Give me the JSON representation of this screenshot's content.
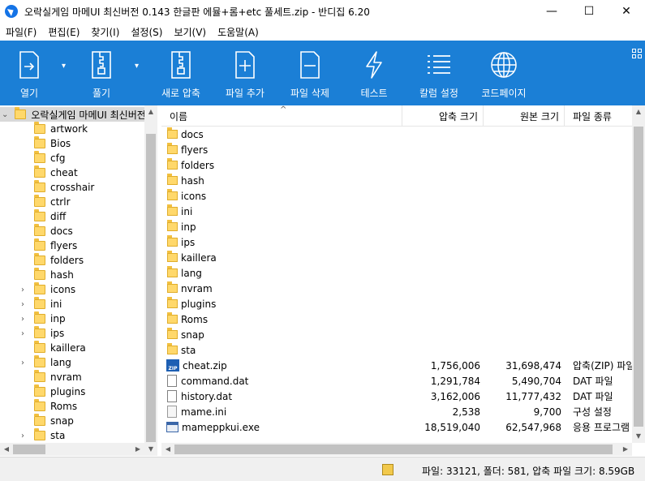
{
  "window": {
    "title": "오락실게임 마메UI 최신버전 0.143 한글판 에뮬+롬+etc 풀세트.zip - 반디집 6.20",
    "minimize": "—",
    "maximize": "☐",
    "close": "✕"
  },
  "menu": [
    "파일(F)",
    "편집(E)",
    "찾기(I)",
    "설정(S)",
    "보기(V)",
    "도움말(A)"
  ],
  "toolbar": {
    "buttons": [
      {
        "label": "열기",
        "icon": "open-icon"
      },
      {
        "label": "풀기",
        "icon": "extract-icon"
      },
      {
        "label": "새로 압축",
        "icon": "new-archive-icon"
      },
      {
        "label": "파일 추가",
        "icon": "add-file-icon"
      },
      {
        "label": "파일 삭제",
        "icon": "delete-file-icon"
      },
      {
        "label": "테스트",
        "icon": "test-icon"
      },
      {
        "label": "칼럼 설정",
        "icon": "column-settings-icon"
      },
      {
        "label": "코드페이지",
        "icon": "globe-icon"
      }
    ],
    "accent": "#1b7fd6"
  },
  "tree": {
    "root": "오락실게임 마메UI 최신버전",
    "items": [
      {
        "label": "artwork",
        "expandable": false
      },
      {
        "label": "Bios",
        "expandable": false
      },
      {
        "label": "cfg",
        "expandable": false
      },
      {
        "label": "cheat",
        "expandable": false
      },
      {
        "label": "crosshair",
        "expandable": false
      },
      {
        "label": "ctrlr",
        "expandable": false
      },
      {
        "label": "diff",
        "expandable": false
      },
      {
        "label": "docs",
        "expandable": false
      },
      {
        "label": "flyers",
        "expandable": false
      },
      {
        "label": "folders",
        "expandable": false
      },
      {
        "label": "hash",
        "expandable": false
      },
      {
        "label": "icons",
        "expandable": true
      },
      {
        "label": "ini",
        "expandable": true
      },
      {
        "label": "inp",
        "expandable": true
      },
      {
        "label": "ips",
        "expandable": true
      },
      {
        "label": "kaillera",
        "expandable": false
      },
      {
        "label": "lang",
        "expandable": true
      },
      {
        "label": "nvram",
        "expandable": false
      },
      {
        "label": "plugins",
        "expandable": false
      },
      {
        "label": "Roms",
        "expandable": false
      },
      {
        "label": "snap",
        "expandable": false
      },
      {
        "label": "sta",
        "expandable": true
      }
    ]
  },
  "columns": {
    "name": "이름",
    "compressed": "압축 크기",
    "original": "원본 크기",
    "type": "파일 종류"
  },
  "files": [
    {
      "name": "docs",
      "kind": "folder",
      "compressed": "",
      "original": "",
      "type": ""
    },
    {
      "name": "flyers",
      "kind": "folder",
      "compressed": "",
      "original": "",
      "type": ""
    },
    {
      "name": "folders",
      "kind": "folder",
      "compressed": "",
      "original": "",
      "type": ""
    },
    {
      "name": "hash",
      "kind": "folder",
      "compressed": "",
      "original": "",
      "type": ""
    },
    {
      "name": "icons",
      "kind": "folder",
      "compressed": "",
      "original": "",
      "type": ""
    },
    {
      "name": "ini",
      "kind": "folder",
      "compressed": "",
      "original": "",
      "type": ""
    },
    {
      "name": "inp",
      "kind": "folder",
      "compressed": "",
      "original": "",
      "type": ""
    },
    {
      "name": "ips",
      "kind": "folder",
      "compressed": "",
      "original": "",
      "type": ""
    },
    {
      "name": "kaillera",
      "kind": "folder",
      "compressed": "",
      "original": "",
      "type": ""
    },
    {
      "name": "lang",
      "kind": "folder",
      "compressed": "",
      "original": "",
      "type": ""
    },
    {
      "name": "nvram",
      "kind": "folder",
      "compressed": "",
      "original": "",
      "type": ""
    },
    {
      "name": "plugins",
      "kind": "folder",
      "compressed": "",
      "original": "",
      "type": ""
    },
    {
      "name": "Roms",
      "kind": "folder",
      "compressed": "",
      "original": "",
      "type": ""
    },
    {
      "name": "snap",
      "kind": "folder",
      "compressed": "",
      "original": "",
      "type": ""
    },
    {
      "name": "sta",
      "kind": "folder",
      "compressed": "",
      "original": "",
      "type": ""
    },
    {
      "name": "cheat.zip",
      "kind": "zip",
      "compressed": "1,756,006",
      "original": "31,698,474",
      "type": "압축(ZIP) 파일"
    },
    {
      "name": "command.dat",
      "kind": "doc",
      "compressed": "1,291,784",
      "original": "5,490,704",
      "type": "DAT 파일"
    },
    {
      "name": "history.dat",
      "kind": "doc",
      "compressed": "3,162,006",
      "original": "11,777,432",
      "type": "DAT 파일"
    },
    {
      "name": "mame.ini",
      "kind": "ini",
      "compressed": "2,538",
      "original": "9,700",
      "type": "구성 설정"
    },
    {
      "name": "mameppkui.exe",
      "kind": "exe",
      "compressed": "18,519,040",
      "original": "62,547,968",
      "type": "응용 프로그램"
    }
  ],
  "status": {
    "text": "파일: 33121, 폴더: 581, 압축 파일 크기: 8.59GB"
  }
}
